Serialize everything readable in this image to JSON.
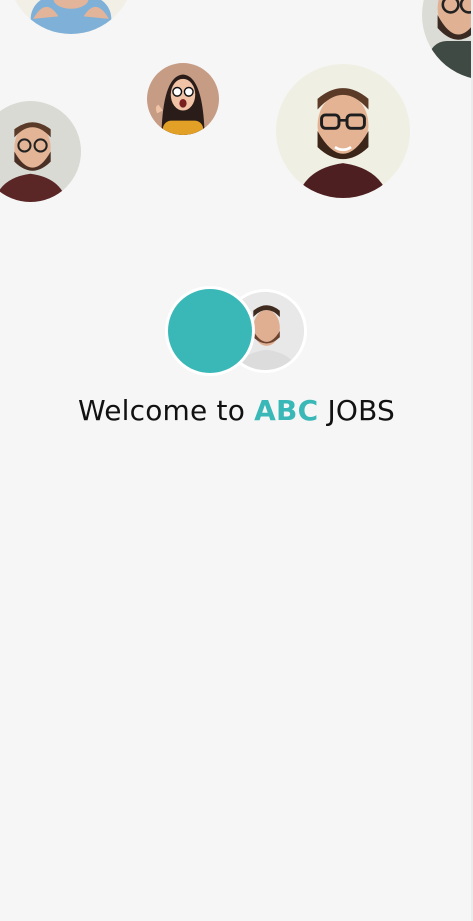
{
  "welcome": {
    "prefix": "Welcome to ",
    "brand": "ABC",
    "suffix": " JOBS"
  },
  "colors": {
    "brand_accent": "#3ab8b8",
    "background": "#f6f6f6"
  },
  "icons": {
    "logo_mark": "teal-circle-logo",
    "profile_photos": [
      "man-glasses-beard",
      "woman-glasses-surprised",
      "man-beard"
    ]
  }
}
